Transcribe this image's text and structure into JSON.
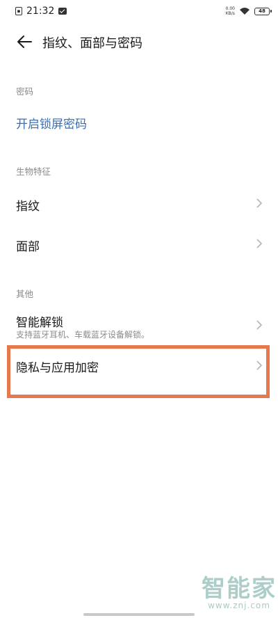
{
  "status_bar": {
    "time": "21:32",
    "net_speed_value": "0.00",
    "net_speed_unit": "KB/s",
    "battery": "48"
  },
  "header": {
    "title": "指纹、面部与密码"
  },
  "sections": {
    "password": {
      "label": "密码",
      "enable_lock_screen": "开启锁屏密码"
    },
    "biometrics": {
      "label": "生物特征",
      "fingerprint": "指纹",
      "face": "面部"
    },
    "other": {
      "label": "其他",
      "smart_unlock": "智能解锁",
      "smart_unlock_desc": "支持蓝牙耳机、车载蓝牙设备解锁。",
      "privacy_encryption": "隐私与应用加密"
    }
  },
  "watermark": {
    "brand": "智能家",
    "url": "www.znj.com"
  },
  "colors": {
    "link": "#3a6db2",
    "highlight": "#e5794b",
    "section_label": "#8a8a8a"
  }
}
